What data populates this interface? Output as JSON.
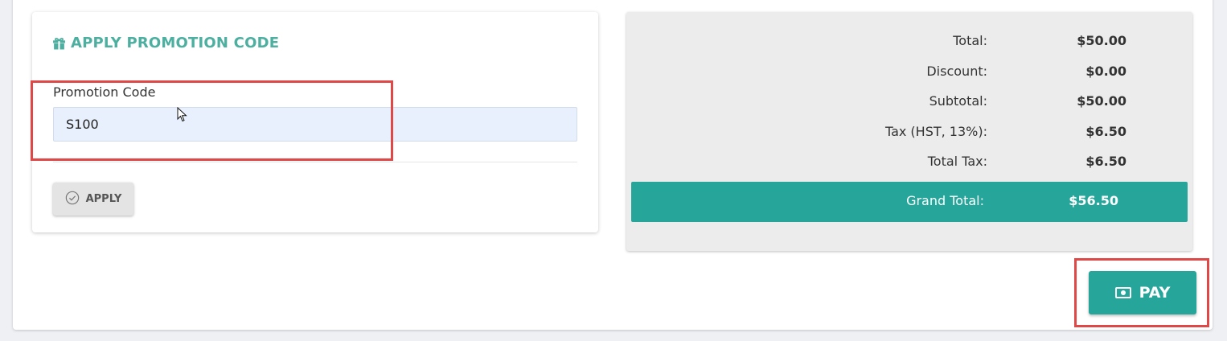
{
  "promo": {
    "title": "APPLY PROMOTION CODE",
    "title_icon": "gift-icon",
    "field_label": "Promotion Code",
    "field_value": "S100",
    "apply_label": "APPLY",
    "apply_icon": "check-circle-icon"
  },
  "summary": {
    "rows": [
      {
        "label": "Total:",
        "value": "$50.00"
      },
      {
        "label": "Discount:",
        "value": "$0.00"
      },
      {
        "label": "Subtotal:",
        "value": "$50.00"
      },
      {
        "label": "Tax (HST, 13%):",
        "value": "$6.50"
      },
      {
        "label": "Total Tax:",
        "value": "$6.50"
      }
    ],
    "grand_total_label": "Grand Total:",
    "grand_total_value": "$56.50"
  },
  "pay": {
    "label": "PAY",
    "icon": "money-icon"
  },
  "colors": {
    "accent": "#26a69a",
    "title_green": "#4caf9f",
    "highlight_red": "#e04848",
    "input_bg": "#e8f0fd"
  }
}
